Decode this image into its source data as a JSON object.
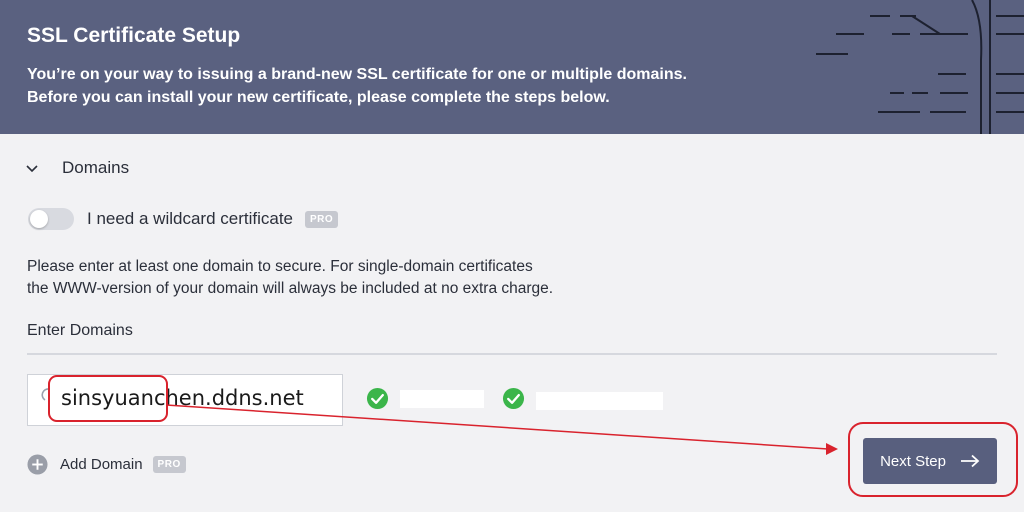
{
  "header": {
    "title": "SSL Certificate Setup",
    "line1": "You’re on your way to issuing a brand-new SSL certificate for one or multiple domains.",
    "line2": "Before you can install your new certificate, please complete the steps below."
  },
  "section": {
    "title": "Domains",
    "expanded": true
  },
  "wildcard": {
    "label": "I need a wildcard certificate",
    "badge": "PRO",
    "enabled": false
  },
  "help": {
    "line1": "Please enter at least one domain to secure. For single-domain certificates",
    "line2": "the WWW-version of your domain will always be included at no extra charge."
  },
  "domains": {
    "label": "Enter Domains",
    "value": "sinsyuanchen.ddns.net"
  },
  "add_domain": {
    "label": "Add Domain",
    "badge": "PRO"
  },
  "next": {
    "label": "Next Step"
  },
  "colors": {
    "header_bg": "#5a6180",
    "button_bg": "#585f7e",
    "check_green": "#3bb54a",
    "annotation_red": "#d9232d"
  },
  "icons": [
    "chevron-down-icon",
    "spinner-icon",
    "check-circle-icon",
    "plus-circle-icon",
    "arrow-right-icon"
  ]
}
